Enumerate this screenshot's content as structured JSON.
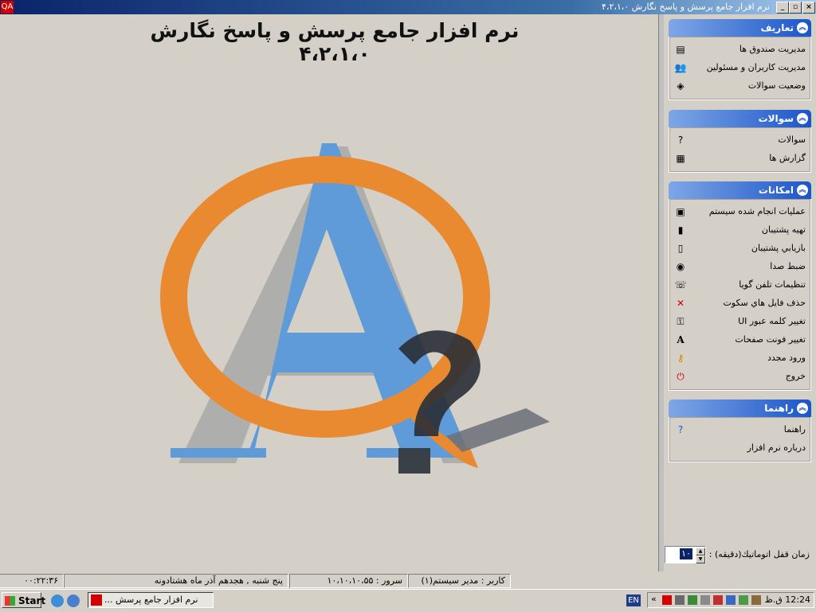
{
  "window": {
    "title": "نرم افزار جامع پرسش و پاسخ نگارش ۴،۲،۱،۰"
  },
  "main": {
    "heading": "نرم افزار جامع پرسش و پاسخ نگارش ۴،۲،۱،۰"
  },
  "panel": {
    "groups": [
      {
        "title": "تعاريف",
        "items": [
          {
            "label": "مديريت صندوق ها",
            "icon": "mailbox-icon"
          },
          {
            "label": "مديريت کاربران و مسئولين",
            "icon": "users-icon"
          },
          {
            "label": "وضعيت سوالات",
            "icon": "status-icon"
          }
        ]
      },
      {
        "title": "سوالات",
        "items": [
          {
            "label": "سوالات",
            "icon": "question-icon"
          },
          {
            "label": "گزارش ها",
            "icon": "report-icon"
          }
        ]
      },
      {
        "title": "امکانات",
        "items": [
          {
            "label": "عمليات انجام شده سيستم",
            "icon": "log-icon"
          },
          {
            "label": "تهيه پشتيبان",
            "icon": "backup-icon"
          },
          {
            "label": "بازيابي پشتيبان",
            "icon": "restore-icon"
          },
          {
            "label": "ضبط صدا",
            "icon": "record-icon"
          },
          {
            "label": "تنظيمات تلفن گويا",
            "icon": "phone-settings-icon"
          },
          {
            "label": "حذف فايل هاي سکوت",
            "icon": "delete-icon"
          },
          {
            "label": "تغيير کلمه عبور UI",
            "icon": "password-icon"
          },
          {
            "label": "تغيير فونت صفحات",
            "icon": "font-icon"
          },
          {
            "label": "ورود مجدد",
            "icon": "relogin-icon"
          },
          {
            "label": "خروج",
            "icon": "exit-icon"
          }
        ]
      },
      {
        "title": "راهنما",
        "items": [
          {
            "label": "راهنما",
            "icon": "help-icon"
          },
          {
            "label": "درباره نرم افزار",
            "icon": ""
          }
        ]
      }
    ],
    "autolock_label": "زمان قفل اتوماتيك(دقيقه) :",
    "autolock_value": "۱۰"
  },
  "statusbar": {
    "user": "کاربر : مدير سيستم(۱)",
    "server": "سرور : ۱۰،۱۰،۱۰،۵۵",
    "date": "پنج شنبه , هجدهم آذر ماه هشتادونه",
    "time": "۰۰:۲۲:۳۶"
  },
  "taskbar": {
    "start_label": "Start",
    "task_label": "نرم افزار جامع پرسش ...",
    "lang": "EN",
    "clock": "12:24 ق.ظ"
  }
}
